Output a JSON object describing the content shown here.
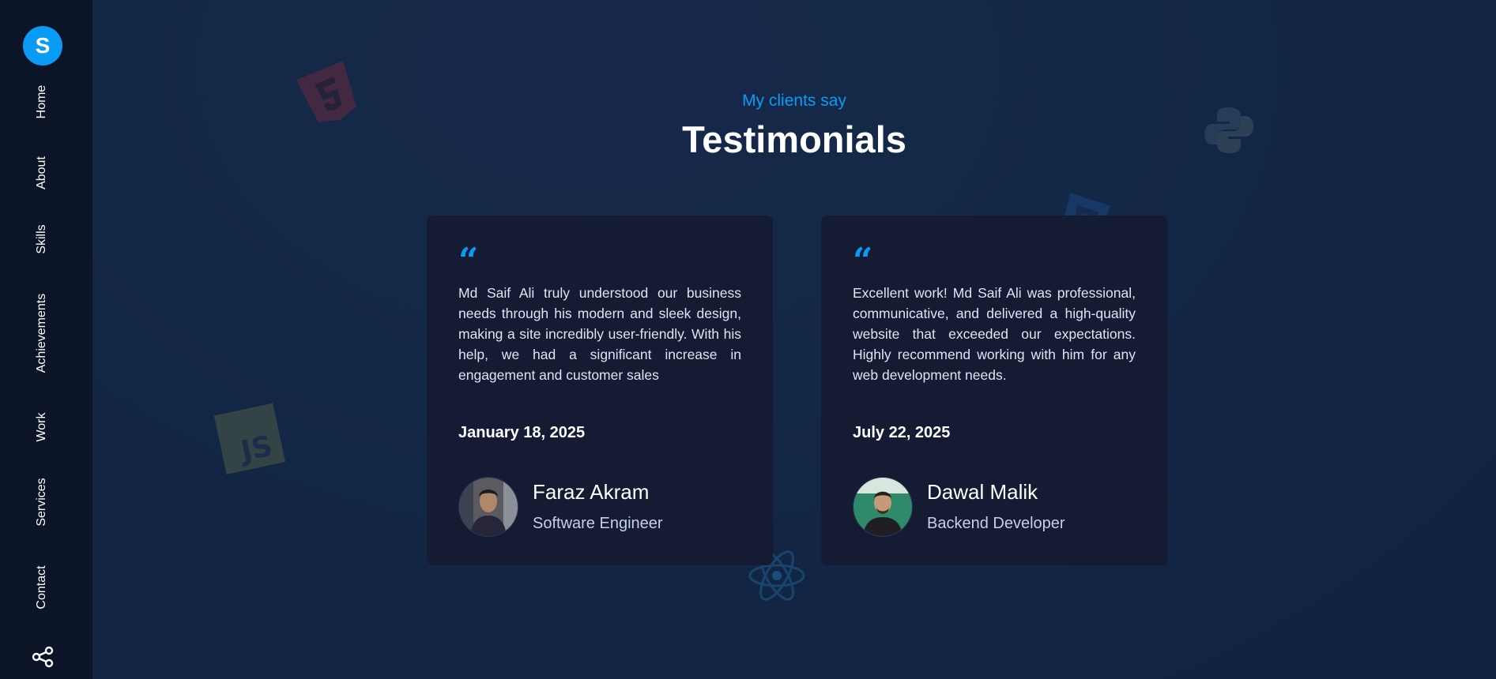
{
  "sidebar": {
    "logo_letter": "S",
    "items": [
      {
        "label": "Home"
      },
      {
        "label": "About"
      },
      {
        "label": "Skills"
      },
      {
        "label": "Achievements"
      },
      {
        "label": "Work"
      },
      {
        "label": "Services"
      },
      {
        "label": "Contact"
      }
    ],
    "share_icon": "share-icon"
  },
  "section": {
    "subtitle": "My clients say",
    "title": "Testimonials"
  },
  "testimonials": [
    {
      "quote": "Md Saif Ali truly understood our business needs through his modern and sleek design, making a site incredibly user-friendly. With his help, we had a significant increase in engagement and customer sales",
      "date": "January 18, 2025",
      "name": "Faraz Akram",
      "role": "Software Engineer"
    },
    {
      "quote": "Excellent work! Md Saif Ali was professional, communicative, and delivered a high-quality website that exceeded our expectations. Highly recommend working with him for any web development needs.",
      "date": "July 22, 2025",
      "name": "Dawal Malik",
      "role": "Backend Developer"
    }
  ],
  "decorations": [
    "html5-icon",
    "javascript-icon",
    "python-icon",
    "css3-icon",
    "react-icon"
  ],
  "colors": {
    "accent": "#0a9bf5",
    "background": "#132746",
    "sidebar": "#0c1528",
    "card": "#141b33"
  }
}
